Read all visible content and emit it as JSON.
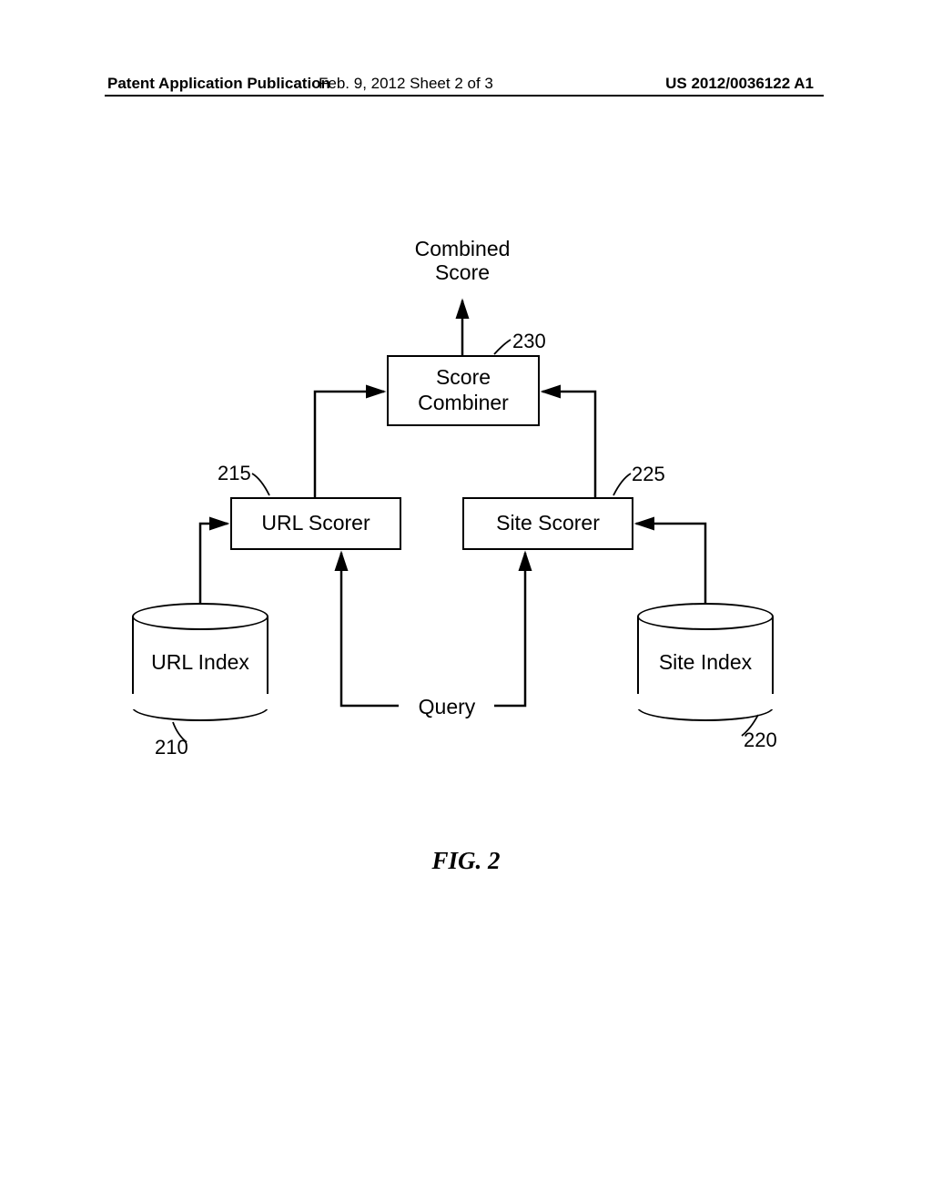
{
  "header": {
    "left": "Patent Application Publication",
    "center": "Feb. 9, 2012   Sheet 2 of 3",
    "right": "US 2012/0036122 A1"
  },
  "diagram": {
    "combined_score": "Combined\nScore",
    "score_combiner": "Score\nCombiner",
    "url_scorer": "URL Scorer",
    "site_scorer": "Site Scorer",
    "url_index": "URL Index",
    "site_index": "Site Index",
    "query": "Query",
    "ref_230": "230",
    "ref_215": "215",
    "ref_225": "225",
    "ref_210": "210",
    "ref_220": "220"
  },
  "figure_caption": "FIG. 2"
}
